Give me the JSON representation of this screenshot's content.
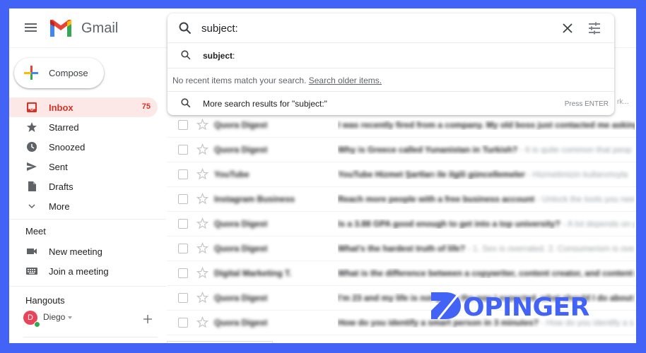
{
  "app": {
    "name": "Gmail"
  },
  "theme": {
    "frame_color": "#4263f5",
    "accent": "#d93025",
    "active_bg": "#fce8e6"
  },
  "compose": {
    "label": "Compose"
  },
  "nav": {
    "items": [
      {
        "label": "Inbox",
        "icon": "inbox-icon",
        "count": "75",
        "active": true
      },
      {
        "label": "Starred",
        "icon": "star-icon"
      },
      {
        "label": "Snoozed",
        "icon": "clock-icon"
      },
      {
        "label": "Sent",
        "icon": "send-icon"
      },
      {
        "label": "Drafts",
        "icon": "draft-icon"
      },
      {
        "label": "More",
        "icon": "chevron-down-icon"
      }
    ]
  },
  "meet": {
    "title": "Meet",
    "items": [
      {
        "label": "New meeting",
        "icon": "video-camera-icon"
      },
      {
        "label": "Join a meeting",
        "icon": "keyboard-icon"
      }
    ]
  },
  "hangouts": {
    "title": "Hangouts",
    "user": {
      "initial": "D",
      "name": "Diego",
      "status": "online"
    }
  },
  "search": {
    "value": "subject:",
    "suggestion_bold": "subject",
    "suggestion_rest": ":",
    "no_recent_text": "No recent items match your search.",
    "search_older_link": "Search older items.",
    "more_results": "More search results for \"subject:\"",
    "press_enter_hint": "Press ENTER"
  },
  "behind_text": "rk...",
  "emails": [
    {
      "sender": "Quora Digest",
      "subject": "I was recently fired from a company. My old boss just contacted me asking",
      "snippet": ""
    },
    {
      "sender": "Quora Digest",
      "subject": "Why is Greece called Yunanistan in Turkish?",
      "snippet": " - It is quite common that peop"
    },
    {
      "sender": "YouTube",
      "subject": "YouTube Hizmet Şartları ile ilgili güncellemeler",
      "snippet": " - Hizmetimizin kullanımıyla"
    },
    {
      "sender": "Instagram Business",
      "subject": "Reach more people with a free business account",
      "snippet": " - Unlock the tools you nee"
    },
    {
      "sender": "Quora Digest",
      "subject": "Is a 3.88 GPA good enough to get into a top university?",
      "snippet": " - A lot depends on y"
    },
    {
      "sender": "Quora Digest",
      "subject": "What's the hardest truth of life?",
      "snippet": " - 1. Sex is overrated. 2. Consumerism is ove"
    },
    {
      "sender": "Digital Marketing T.",
      "subject": "What is the difference between a copywriter, content creator, and content m",
      "snippet": ""
    },
    {
      "sender": "Quora Digest",
      "subject": "I'm 23 and my life is not going the way I expected, what should I do about it or",
      "snippet": ""
    },
    {
      "sender": "Quora Digest",
      "subject": "How do you identify a smart person in 3 minutes?",
      "snippet": " - How do you identify a s"
    }
  ],
  "watermark": {
    "text": "OPINGER",
    "brand": "DOPINGER"
  }
}
